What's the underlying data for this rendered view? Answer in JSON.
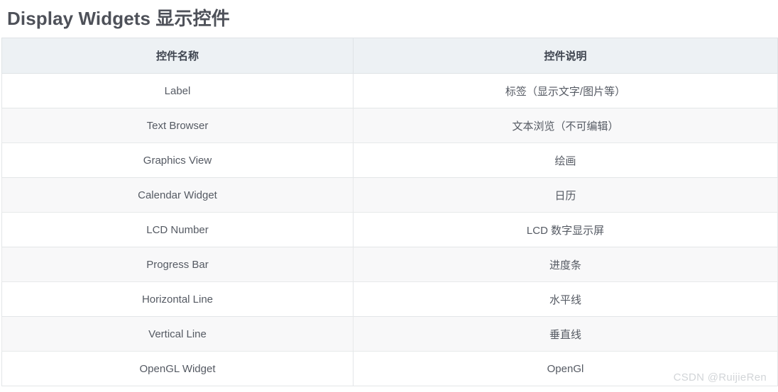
{
  "page": {
    "title": "Display Widgets 显示控件",
    "watermark": "CSDN @RuijieRen"
  },
  "table": {
    "columns": [
      {
        "key": "name",
        "label": "控件名称"
      },
      {
        "key": "desc",
        "label": "控件说明"
      }
    ],
    "rows": [
      {
        "name": "Label",
        "desc": "标签（显示文字/图片等）"
      },
      {
        "name": "Text Browser",
        "desc": "文本浏览（不可编辑）"
      },
      {
        "name": "Graphics View",
        "desc": "绘画"
      },
      {
        "name": "Calendar Widget",
        "desc": "日历"
      },
      {
        "name": "LCD Number",
        "desc": "LCD 数字显示屏"
      },
      {
        "name": "Progress Bar",
        "desc": "进度条"
      },
      {
        "name": "Horizontal Line",
        "desc": "水平线"
      },
      {
        "name": "Vertical Line",
        "desc": "垂直线"
      },
      {
        "name": "OpenGL Widget",
        "desc": "OpenGl"
      }
    ]
  },
  "colors": {
    "title_text": "#4e5159",
    "header_bg": "#edf1f4",
    "header_text": "#3f4550",
    "row_text": "#555a63",
    "row_alt_bg": "#f8f8f9",
    "border": "#e3e6e8",
    "watermark_text": "#d2d5d8"
  }
}
